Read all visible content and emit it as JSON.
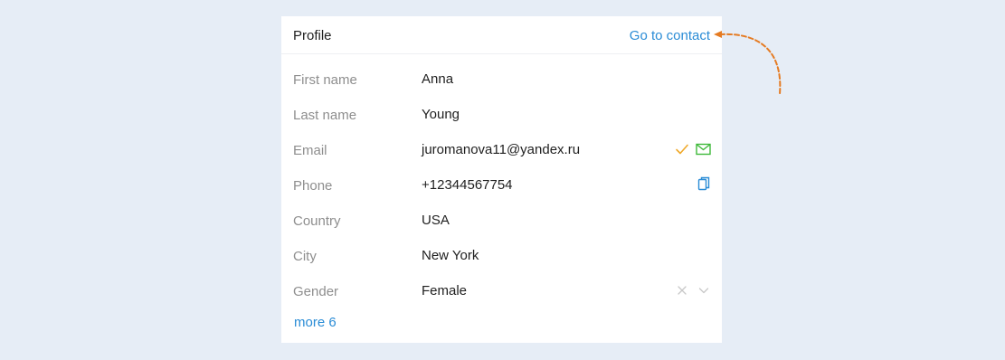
{
  "profile": {
    "title": "Profile",
    "go_to_contact": "Go to contact",
    "fields": [
      {
        "label": "First name",
        "value": "Anna"
      },
      {
        "label": "Last name",
        "value": "Young"
      },
      {
        "label": "Email",
        "value": "juromanova11@yandex.ru"
      },
      {
        "label": "Phone",
        "value": "+12344567754"
      },
      {
        "label": "Country",
        "value": "USA"
      },
      {
        "label": "City",
        "value": "New York"
      },
      {
        "label": "Gender",
        "value": "Female"
      }
    ],
    "more": "more 6"
  },
  "icons": {
    "email_verified": "check-icon",
    "send_email": "envelope-icon",
    "copy_phone": "copy-icon",
    "clear_gender": "close-icon",
    "gender_dropdown": "chevron-down-icon"
  },
  "colors": {
    "background": "#e6edf6",
    "card": "#ffffff",
    "link": "#2a8cd6",
    "label": "#8e8e8e",
    "value": "#1f1f1f",
    "check": "#f0a92a",
    "envelope": "#3fb93a",
    "annotation_arrow": "#e57b22"
  }
}
